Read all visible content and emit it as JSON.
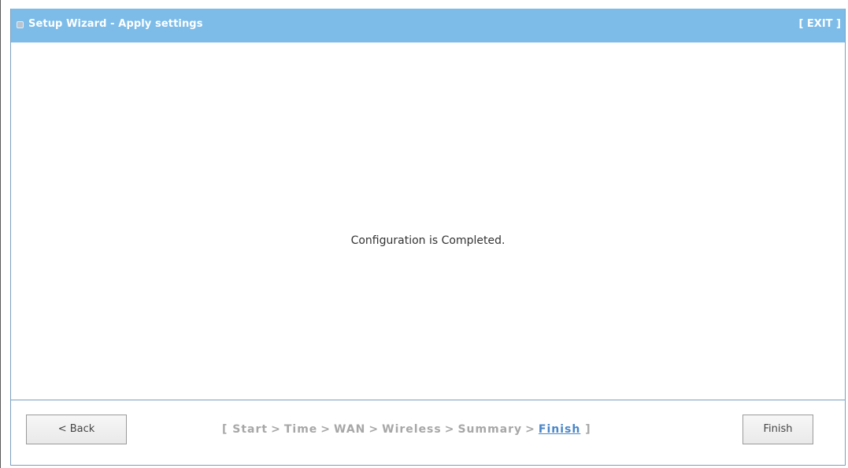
{
  "window": {
    "title": "Setup Wizard - Apply settings",
    "exit_label": "[ EXIT ]"
  },
  "content": {
    "message": "Configuration is Completed."
  },
  "footer": {
    "back_label": "< Back",
    "finish_label": "Finish",
    "steps_open": "[",
    "steps_close": "]",
    "steps": [
      "Start",
      "Time",
      "WAN",
      "Wireless",
      "Summary",
      "Finish"
    ],
    "step_separator": ">",
    "current_step_index": 5
  },
  "colors": {
    "title_bar": "#7dbce8",
    "current_step": "#4a86c8",
    "inactive_step": "#a7a7a7"
  }
}
